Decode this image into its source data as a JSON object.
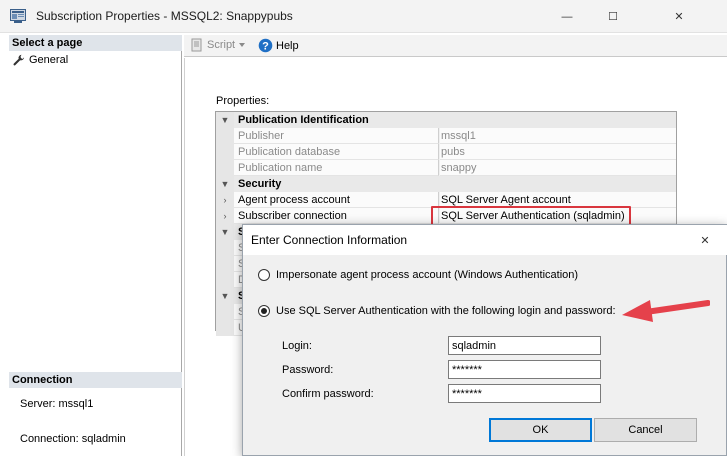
{
  "window": {
    "title": "Subscription Properties - MSSQL2: Snappypubs",
    "minimize_glyph": "—",
    "maximize_glyph": "☐",
    "close_glyph": "✕"
  },
  "left": {
    "select_page_header": "Select a page",
    "pages": [
      {
        "label": "General",
        "icon": "wrench-icon"
      }
    ],
    "connection_header": "Connection",
    "server_text": "Server: mssql1",
    "connection_text": "Connection: sqladmin"
  },
  "toolbar": {
    "script_label": "Script",
    "help_label": "Help"
  },
  "properties": {
    "label": "Properties:",
    "categories": [
      {
        "name": "Publication Identification",
        "rows": [
          {
            "name": "Publisher",
            "value": "mssql1"
          },
          {
            "name": "Publication database",
            "value": "pubs"
          },
          {
            "name": "Publication name",
            "value": "snappy"
          }
        ]
      },
      {
        "name": "Security",
        "rows": [
          {
            "name": "Agent process account",
            "value": "SQL Server Agent account"
          },
          {
            "name": "Subscriber connection",
            "value": "SQL Server Authentication (sqladmin)"
          }
        ]
      }
    ],
    "partial_rows": [
      "S",
      "S",
      "S",
      "D",
      "S",
      "S",
      "U"
    ]
  },
  "dialog": {
    "title": "Enter Connection Information",
    "close_glyph": "✕",
    "option_impersonate": "Impersonate agent process account (Windows Authentication)",
    "option_sql_auth": "Use SQL Server Authentication with the following login and password:",
    "selected_option": "sql_auth",
    "login_label": "Login:",
    "login_value": "sqladmin",
    "password_label": "Password:",
    "password_value": "*******",
    "confirm_label": "Confirm password:",
    "confirm_value": "*******",
    "ok_label": "OK",
    "cancel_label": "Cancel"
  },
  "colors": {
    "highlight_border": "#d9363e",
    "arrow": "#e5414b",
    "default_button_border": "#0078d7"
  }
}
